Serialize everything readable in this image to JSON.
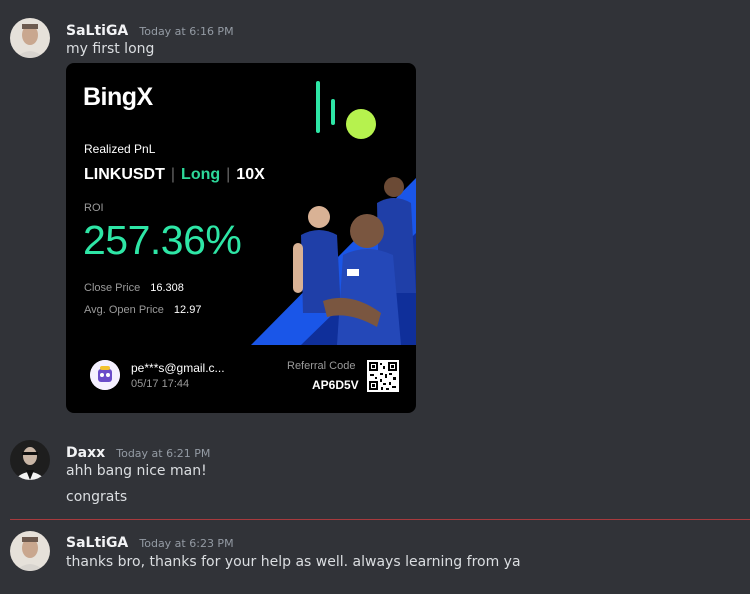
{
  "messages": [
    {
      "username": "SaLtiGA",
      "timestamp": "Today at 6:16 PM",
      "lines": [
        "my first long"
      ]
    },
    {
      "username": "Daxx",
      "timestamp": "Today at 6:21 PM",
      "lines": [
        "ahh bang nice man!",
        "congrats"
      ]
    },
    {
      "username": "SaLtiGA",
      "timestamp": "Today at 6:23 PM",
      "lines": [
        "thanks bro, thanks for your help as well. always learning from ya"
      ]
    }
  ],
  "pnl_card": {
    "brand": "BingX",
    "title": "Realized PnL",
    "pair": "LINKUSDT",
    "direction": "Long",
    "leverage": "10X",
    "roi_label": "ROI",
    "roi_value": "257.36%",
    "close_price_label": "Close Price",
    "close_price": "16.308",
    "open_price_label": "Avg. Open Price",
    "open_price": "12.97",
    "email": "pe***s@gmail.c...",
    "date": "05/17 17:44",
    "referral_label": "Referral Code",
    "referral_code": "AP6D5V",
    "colors": {
      "accent": "#2ee6a6",
      "background": "#000000",
      "team_blue": "#1f3fa8"
    }
  },
  "theme": {
    "background": "#313338",
    "divider_new_messages": "#a83a3d"
  }
}
